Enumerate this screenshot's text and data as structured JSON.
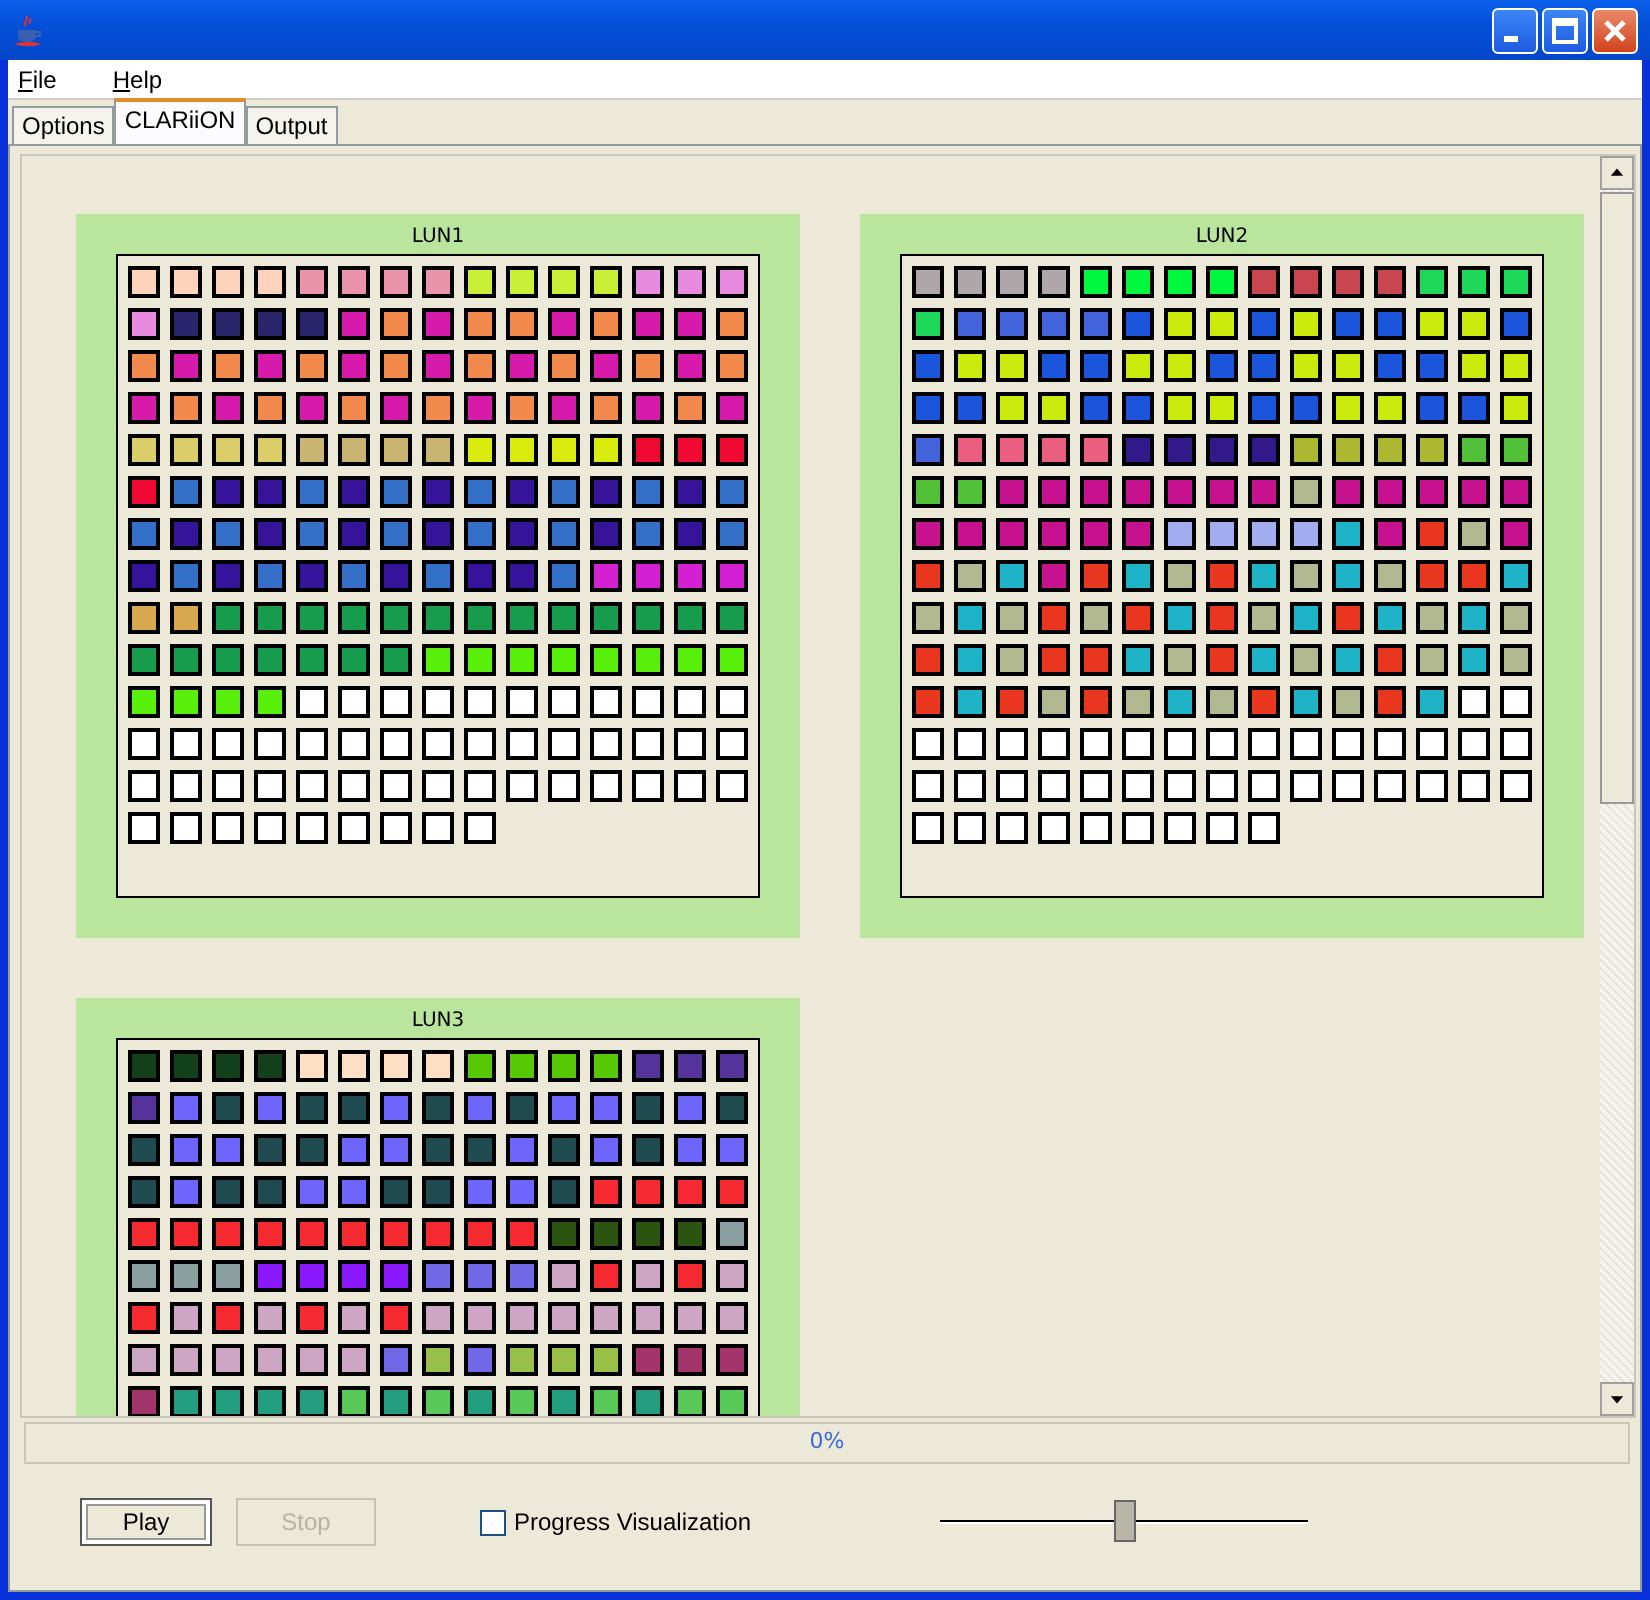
{
  "menu": [
    {
      "label": "File"
    },
    {
      "label": "Help"
    }
  ],
  "tabs": [
    {
      "label": "Options",
      "selected": false
    },
    {
      "label": "CLARiiON",
      "selected": true
    },
    {
      "label": "Output",
      "selected": false
    }
  ],
  "luns": [
    {
      "title": "LUN1",
      "blocks": [
        {
          "color": "#fdd3bb"
        },
        {
          "color": "#fdd3bb"
        },
        {
          "color": "#fdd3bb"
        },
        {
          "color": "#fdd3bb"
        },
        {
          "color": "#ea93ab"
        },
        {
          "color": "#ea93ab"
        },
        {
          "color": "#ea93ab"
        },
        {
          "color": "#ea93ab"
        },
        {
          "color": "#cbef37"
        },
        {
          "color": "#cbef37"
        },
        {
          "color": "#cbef37"
        },
        {
          "color": "#cbef37"
        },
        {
          "color": "#e88ae0"
        },
        {
          "color": "#e88ae0"
        },
        {
          "color": "#e88ae0"
        },
        {
          "color": "#e88ae0"
        },
        {
          "color": "#2a246a"
        },
        {
          "color": "#2a246a"
        },
        {
          "color": "#2a246a"
        },
        {
          "color": "#2a246a"
        },
        {
          "color": "#d61aac"
        },
        {
          "color": "#f28a4e"
        },
        {
          "color": "#d61aac"
        },
        {
          "color": "#f28a4e"
        },
        {
          "color": "#f28a4e"
        },
        {
          "color": "#d61aac"
        },
        {
          "color": "#f28a4e"
        },
        {
          "color": "#d61aac"
        },
        {
          "color": "#d61aac"
        },
        {
          "color": "#f28a4e"
        },
        {
          "color": "#f28a4e"
        },
        {
          "color": "#d61aac"
        },
        {
          "color": "#f28a4e"
        },
        {
          "color": "#d61aac"
        },
        {
          "color": "#f28a4e"
        },
        {
          "color": "#d61aac"
        },
        {
          "color": "#f28a4e"
        },
        {
          "color": "#d61aac"
        },
        {
          "color": "#f28a4e"
        },
        {
          "color": "#d61aac"
        },
        {
          "color": "#f28a4e"
        },
        {
          "color": "#d61aac"
        },
        {
          "color": "#f28a4e"
        },
        {
          "color": "#d61aac"
        },
        {
          "color": "#f28a4e"
        },
        {
          "color": "#d61aac"
        },
        {
          "color": "#f28a4e"
        },
        {
          "color": "#d61aac"
        },
        {
          "color": "#f28a4e"
        },
        {
          "color": "#d61aac"
        },
        {
          "color": "#f28a4e"
        },
        {
          "color": "#d61aac"
        },
        {
          "color": "#f28a4e"
        },
        {
          "color": "#d61aac"
        },
        {
          "color": "#f28a4e"
        },
        {
          "color": "#d61aac"
        },
        {
          "color": "#f28a4e"
        },
        {
          "color": "#d61aac"
        },
        {
          "color": "#f28a4e"
        },
        {
          "color": "#d61aac"
        },
        {
          "color": "#dbcd69"
        },
        {
          "color": "#dbcd69"
        },
        {
          "color": "#dbcd69"
        },
        {
          "color": "#dbcd69"
        },
        {
          "color": "#c9b472"
        },
        {
          "color": "#c9b472"
        },
        {
          "color": "#c9b472"
        },
        {
          "color": "#c9b472"
        },
        {
          "color": "#d9ec0e"
        },
        {
          "color": "#d9ec0e"
        },
        {
          "color": "#d9ec0e"
        },
        {
          "color": "#d9ec0e"
        },
        {
          "color": "#f00a33"
        },
        {
          "color": "#f00a33"
        },
        {
          "color": "#f00a33"
        },
        {
          "color": "#f00a33"
        },
        {
          "color": "#3570c8"
        },
        {
          "color": "#36149a"
        },
        {
          "color": "#36149a"
        },
        {
          "color": "#3570c8"
        },
        {
          "color": "#36149a"
        },
        {
          "color": "#3570c8"
        },
        {
          "color": "#36149a"
        },
        {
          "color": "#3570c8"
        },
        {
          "color": "#36149a"
        },
        {
          "color": "#3570c8"
        },
        {
          "color": "#36149a"
        },
        {
          "color": "#3570c8"
        },
        {
          "color": "#36149a"
        },
        {
          "color": "#3570c8"
        },
        {
          "color": "#3570c8"
        },
        {
          "color": "#36149a"
        },
        {
          "color": "#3570c8"
        },
        {
          "color": "#36149a"
        },
        {
          "color": "#3570c8"
        },
        {
          "color": "#36149a"
        },
        {
          "color": "#3570c8"
        },
        {
          "color": "#36149a"
        },
        {
          "color": "#3570c8"
        },
        {
          "color": "#36149a"
        },
        {
          "color": "#3570c8"
        },
        {
          "color": "#36149a"
        },
        {
          "color": "#3570c8"
        },
        {
          "color": "#36149a"
        },
        {
          "color": "#3570c8"
        },
        {
          "color": "#36149a"
        },
        {
          "color": "#3570c8"
        },
        {
          "color": "#36149a"
        },
        {
          "color": "#3570c8"
        },
        {
          "color": "#36149a"
        },
        {
          "color": "#3570c8"
        },
        {
          "color": "#36149a"
        },
        {
          "color": "#3570c8"
        },
        {
          "color": "#36149a"
        },
        {
          "color": "#36149a"
        },
        {
          "color": "#3570c8"
        },
        {
          "color": "#d41fd2"
        },
        {
          "color": "#d41fd2"
        },
        {
          "color": "#d41fd2"
        },
        {
          "color": "#d41fd2"
        },
        {
          "color": "#d8a84e"
        },
        {
          "color": "#d8a84e"
        },
        {
          "color": "#179c4e"
        },
        {
          "color": "#179c4e"
        },
        {
          "color": "#179c4e"
        },
        {
          "color": "#179c4e"
        },
        {
          "color": "#179c4e"
        },
        {
          "color": "#179c4e"
        },
        {
          "color": "#179c4e"
        },
        {
          "color": "#179c4e"
        },
        {
          "color": "#179c4e"
        },
        {
          "color": "#179c4e"
        },
        {
          "color": "#179c4e"
        },
        {
          "color": "#179c4e"
        },
        {
          "color": "#179c4e"
        },
        {
          "color": "#179c4e"
        },
        {
          "color": "#179c4e"
        },
        {
          "color": "#179c4e"
        },
        {
          "color": "#179c4e"
        },
        {
          "color": "#179c4e"
        },
        {
          "color": "#179c4e"
        },
        {
          "color": "#179c4e"
        },
        {
          "color": "#58f00a"
        },
        {
          "color": "#58f00a"
        },
        {
          "color": "#58f00a"
        },
        {
          "color": "#58f00a"
        },
        {
          "color": "#58f00a"
        },
        {
          "color": "#58f00a"
        },
        {
          "color": "#58f00a"
        },
        {
          "color": "#58f00a"
        },
        {
          "color": "#58f00a"
        },
        {
          "color": "#58f00a"
        },
        {
          "color": "#58f00a"
        },
        {
          "color": "#58f00a"
        },
        {
          "color": "#ffffff"
        },
        {
          "color": "#ffffff"
        },
        {
          "color": "#ffffff"
        },
        {
          "color": "#ffffff"
        },
        {
          "color": "#ffffff"
        },
        {
          "color": "#ffffff"
        },
        {
          "color": "#ffffff"
        },
        {
          "color": "#ffffff"
        },
        {
          "color": "#ffffff"
        },
        {
          "color": "#ffffff"
        },
        {
          "color": "#ffffff"
        },
        {
          "color": "#ffffff"
        },
        {
          "color": "#ffffff"
        },
        {
          "color": "#ffffff"
        },
        {
          "color": "#ffffff"
        },
        {
          "color": "#ffffff"
        },
        {
          "color": "#ffffff"
        },
        {
          "color": "#ffffff"
        },
        {
          "color": "#ffffff"
        },
        {
          "color": "#ffffff"
        },
        {
          "color": "#ffffff"
        },
        {
          "color": "#ffffff"
        },
        {
          "color": "#ffffff"
        },
        {
          "color": "#ffffff"
        },
        {
          "color": "#ffffff"
        },
        {
          "color": "#ffffff"
        },
        {
          "color": "#ffffff"
        },
        {
          "color": "#ffffff"
        },
        {
          "color": "#ffffff"
        },
        {
          "color": "#ffffff"
        },
        {
          "color": "#ffffff"
        },
        {
          "color": "#ffffff"
        },
        {
          "color": "#ffffff"
        },
        {
          "color": "#ffffff"
        },
        {
          "color": "#ffffff"
        },
        {
          "color": "#ffffff"
        },
        {
          "color": "#ffffff"
        },
        {
          "color": "#ffffff"
        },
        {
          "color": "#ffffff"
        },
        {
          "color": "#ffffff"
        },
        {
          "color": "#ffffff"
        },
        {
          "color": "#ffffff"
        },
        {
          "color": "#ffffff"
        },
        {
          "color": "#ffffff"
        },
        {
          "color": "#ffffff"
        },
        {
          "color": "#ffffff"
        },
        {
          "color": "#ffffff"
        },
        {
          "color": "#ffffff"
        },
        {
          "color": "#ffffff"
        },
        {
          "color": "#ffffff"
        }
      ]
    },
    {
      "title": "LUN2",
      "blocks": [
        {
          "color": "#aea6a8"
        },
        {
          "color": "#aea6a8"
        },
        {
          "color": "#aea6a8"
        },
        {
          "color": "#aea6a8"
        },
        {
          "color": "#00f83f"
        },
        {
          "color": "#00f83f"
        },
        {
          "color": "#00f83f"
        },
        {
          "color": "#00f83f"
        },
        {
          "color": "#c84650"
        },
        {
          "color": "#c84650"
        },
        {
          "color": "#c84650"
        },
        {
          "color": "#c84650"
        },
        {
          "color": "#1ed859"
        },
        {
          "color": "#1ed859"
        },
        {
          "color": "#1ed859"
        },
        {
          "color": "#1ed859"
        },
        {
          "color": "#4263da"
        },
        {
          "color": "#4263da"
        },
        {
          "color": "#4263da"
        },
        {
          "color": "#4263da"
        },
        {
          "color": "#1a55dc"
        },
        {
          "color": "#cbeb0c"
        },
        {
          "color": "#cbeb0c"
        },
        {
          "color": "#1a55dc"
        },
        {
          "color": "#cbeb0c"
        },
        {
          "color": "#1a55dc"
        },
        {
          "color": "#1a55dc"
        },
        {
          "color": "#cbeb0c"
        },
        {
          "color": "#cbeb0c"
        },
        {
          "color": "#1a55dc"
        },
        {
          "color": "#1a55dc"
        },
        {
          "color": "#cbeb0c"
        },
        {
          "color": "#cbeb0c"
        },
        {
          "color": "#1a55dc"
        },
        {
          "color": "#1a55dc"
        },
        {
          "color": "#cbeb0c"
        },
        {
          "color": "#cbeb0c"
        },
        {
          "color": "#1a55dc"
        },
        {
          "color": "#1a55dc"
        },
        {
          "color": "#cbeb0c"
        },
        {
          "color": "#cbeb0c"
        },
        {
          "color": "#1a55dc"
        },
        {
          "color": "#1a55dc"
        },
        {
          "color": "#cbeb0c"
        },
        {
          "color": "#cbeb0c"
        },
        {
          "color": "#1a55dc"
        },
        {
          "color": "#1a55dc"
        },
        {
          "color": "#cbeb0c"
        },
        {
          "color": "#cbeb0c"
        },
        {
          "color": "#1a55dc"
        },
        {
          "color": "#1a55dc"
        },
        {
          "color": "#cbeb0c"
        },
        {
          "color": "#cbeb0c"
        },
        {
          "color": "#1a55dc"
        },
        {
          "color": "#1a55dc"
        },
        {
          "color": "#cbeb0c"
        },
        {
          "color": "#cbeb0c"
        },
        {
          "color": "#1a55dc"
        },
        {
          "color": "#1a55dc"
        },
        {
          "color": "#cbeb0c"
        },
        {
          "color": "#4263da"
        },
        {
          "color": "#ea5e80"
        },
        {
          "color": "#ea5e80"
        },
        {
          "color": "#ea5e80"
        },
        {
          "color": "#ea5e80"
        },
        {
          "color": "#31198a"
        },
        {
          "color": "#31198a"
        },
        {
          "color": "#31198a"
        },
        {
          "color": "#31198a"
        },
        {
          "color": "#adb832"
        },
        {
          "color": "#adb832"
        },
        {
          "color": "#adb832"
        },
        {
          "color": "#adb832"
        },
        {
          "color": "#52c038"
        },
        {
          "color": "#52c038"
        },
        {
          "color": "#52c038"
        },
        {
          "color": "#52c038"
        },
        {
          "color": "#c6128e"
        },
        {
          "color": "#c6128e"
        },
        {
          "color": "#c6128e"
        },
        {
          "color": "#c6128e"
        },
        {
          "color": "#c6128e"
        },
        {
          "color": "#c6128e"
        },
        {
          "color": "#c6128e"
        },
        {
          "color": "#b2b990"
        },
        {
          "color": "#c6128e"
        },
        {
          "color": "#c6128e"
        },
        {
          "color": "#c6128e"
        },
        {
          "color": "#c6128e"
        },
        {
          "color": "#c6128e"
        },
        {
          "color": "#c6128e"
        },
        {
          "color": "#c6128e"
        },
        {
          "color": "#c6128e"
        },
        {
          "color": "#c6128e"
        },
        {
          "color": "#c6128e"
        },
        {
          "color": "#c6128e"
        },
        {
          "color": "#a0aef0"
        },
        {
          "color": "#a0aef0"
        },
        {
          "color": "#a0aef0"
        },
        {
          "color": "#a0aef0"
        },
        {
          "color": "#1fb3c8"
        },
        {
          "color": "#c6128e"
        },
        {
          "color": "#e8361f"
        },
        {
          "color": "#b2b990"
        },
        {
          "color": "#c6128e"
        },
        {
          "color": "#e8361f"
        },
        {
          "color": "#b2b990"
        },
        {
          "color": "#1fb3c8"
        },
        {
          "color": "#c6128e"
        },
        {
          "color": "#e8361f"
        },
        {
          "color": "#1fb3c8"
        },
        {
          "color": "#b2b990"
        },
        {
          "color": "#e8361f"
        },
        {
          "color": "#1fb3c8"
        },
        {
          "color": "#b2b990"
        },
        {
          "color": "#1fb3c8"
        },
        {
          "color": "#b2b990"
        },
        {
          "color": "#e8361f"
        },
        {
          "color": "#e8361f"
        },
        {
          "color": "#1fb3c8"
        },
        {
          "color": "#b2b990"
        },
        {
          "color": "#1fb3c8"
        },
        {
          "color": "#b2b990"
        },
        {
          "color": "#e8361f"
        },
        {
          "color": "#b2b990"
        },
        {
          "color": "#e8361f"
        },
        {
          "color": "#1fb3c8"
        },
        {
          "color": "#e8361f"
        },
        {
          "color": "#b2b990"
        },
        {
          "color": "#1fb3c8"
        },
        {
          "color": "#e8361f"
        },
        {
          "color": "#1fb3c8"
        },
        {
          "color": "#b2b990"
        },
        {
          "color": "#1fb3c8"
        },
        {
          "color": "#b2b990"
        },
        {
          "color": "#e8361f"
        },
        {
          "color": "#1fb3c8"
        },
        {
          "color": "#b2b990"
        },
        {
          "color": "#e8361f"
        },
        {
          "color": "#e8361f"
        },
        {
          "color": "#1fb3c8"
        },
        {
          "color": "#b2b990"
        },
        {
          "color": "#e8361f"
        },
        {
          "color": "#1fb3c8"
        },
        {
          "color": "#b2b990"
        },
        {
          "color": "#1fb3c8"
        },
        {
          "color": "#e8361f"
        },
        {
          "color": "#b2b990"
        },
        {
          "color": "#1fb3c8"
        },
        {
          "color": "#b2b990"
        },
        {
          "color": "#e8361f"
        },
        {
          "color": "#1fb3c8"
        },
        {
          "color": "#e8361f"
        },
        {
          "color": "#b2b990"
        },
        {
          "color": "#e8361f"
        },
        {
          "color": "#b2b990"
        },
        {
          "color": "#1fb3c8"
        },
        {
          "color": "#b2b990"
        },
        {
          "color": "#e8361f"
        },
        {
          "color": "#1fb3c8"
        },
        {
          "color": "#b2b990"
        },
        {
          "color": "#e8361f"
        },
        {
          "color": "#1fb3c8"
        },
        {
          "color": "#ffffff"
        },
        {
          "color": "#ffffff"
        },
        {
          "color": "#ffffff"
        },
        {
          "color": "#ffffff"
        },
        {
          "color": "#ffffff"
        },
        {
          "color": "#ffffff"
        },
        {
          "color": "#ffffff"
        },
        {
          "color": "#ffffff"
        },
        {
          "color": "#ffffff"
        },
        {
          "color": "#ffffff"
        },
        {
          "color": "#ffffff"
        },
        {
          "color": "#ffffff"
        },
        {
          "color": "#ffffff"
        },
        {
          "color": "#ffffff"
        },
        {
          "color": "#ffffff"
        },
        {
          "color": "#ffffff"
        },
        {
          "color": "#ffffff"
        },
        {
          "color": "#ffffff"
        },
        {
          "color": "#ffffff"
        },
        {
          "color": "#ffffff"
        },
        {
          "color": "#ffffff"
        },
        {
          "color": "#ffffff"
        },
        {
          "color": "#ffffff"
        },
        {
          "color": "#ffffff"
        },
        {
          "color": "#ffffff"
        },
        {
          "color": "#ffffff"
        },
        {
          "color": "#ffffff"
        },
        {
          "color": "#ffffff"
        },
        {
          "color": "#ffffff"
        },
        {
          "color": "#ffffff"
        },
        {
          "color": "#ffffff"
        },
        {
          "color": "#ffffff"
        },
        {
          "color": "#ffffff"
        },
        {
          "color": "#ffffff"
        },
        {
          "color": "#ffffff"
        },
        {
          "color": "#ffffff"
        },
        {
          "color": "#ffffff"
        },
        {
          "color": "#ffffff"
        },
        {
          "color": "#ffffff"
        },
        {
          "color": "#ffffff"
        },
        {
          "color": "#ffffff"
        }
      ]
    },
    {
      "title": "LUN3",
      "blocks": [
        {
          "color": "#12401a"
        },
        {
          "color": "#12401a"
        },
        {
          "color": "#12401a"
        },
        {
          "color": "#12401a"
        },
        {
          "color": "#fde0c4"
        },
        {
          "color": "#fde0c4"
        },
        {
          "color": "#fde0c4"
        },
        {
          "color": "#fde0c4"
        },
        {
          "color": "#56c806"
        },
        {
          "color": "#56c806"
        },
        {
          "color": "#56c806"
        },
        {
          "color": "#56c806"
        },
        {
          "color": "#54349a"
        },
        {
          "color": "#54349a"
        },
        {
          "color": "#54349a"
        },
        {
          "color": "#54349a"
        },
        {
          "color": "#6e66fc"
        },
        {
          "color": "#1e4a50"
        },
        {
          "color": "#6e66fc"
        },
        {
          "color": "#1e4a50"
        },
        {
          "color": "#1e4a50"
        },
        {
          "color": "#6e66fc"
        },
        {
          "color": "#1e4a50"
        },
        {
          "color": "#6e66fc"
        },
        {
          "color": "#1e4a50"
        },
        {
          "color": "#6e66fc"
        },
        {
          "color": "#6e66fc"
        },
        {
          "color": "#1e4a50"
        },
        {
          "color": "#6e66fc"
        },
        {
          "color": "#1e4a50"
        },
        {
          "color": "#1e4a50"
        },
        {
          "color": "#6e66fc"
        },
        {
          "color": "#6e66fc"
        },
        {
          "color": "#1e4a50"
        },
        {
          "color": "#1e4a50"
        },
        {
          "color": "#6e66fc"
        },
        {
          "color": "#6e66fc"
        },
        {
          "color": "#1e4a50"
        },
        {
          "color": "#1e4a50"
        },
        {
          "color": "#6e66fc"
        },
        {
          "color": "#1e4a50"
        },
        {
          "color": "#6e66fc"
        },
        {
          "color": "#1e4a50"
        },
        {
          "color": "#6e66fc"
        },
        {
          "color": "#6e66fc"
        },
        {
          "color": "#1e4a50"
        },
        {
          "color": "#6e66fc"
        },
        {
          "color": "#1e4a50"
        },
        {
          "color": "#1e4a50"
        },
        {
          "color": "#6e66fc"
        },
        {
          "color": "#6e66fc"
        },
        {
          "color": "#1e4a50"
        },
        {
          "color": "#1e4a50"
        },
        {
          "color": "#6e66fc"
        },
        {
          "color": "#6e66fc"
        },
        {
          "color": "#1e4a50"
        },
        {
          "color": "#f42a30"
        },
        {
          "color": "#f42a30"
        },
        {
          "color": "#f42a30"
        },
        {
          "color": "#f42a30"
        },
        {
          "color": "#f42a30"
        },
        {
          "color": "#f42a30"
        },
        {
          "color": "#f42a30"
        },
        {
          "color": "#f42a30"
        },
        {
          "color": "#f42a30"
        },
        {
          "color": "#f42a30"
        },
        {
          "color": "#f42a30"
        },
        {
          "color": "#f42a30"
        },
        {
          "color": "#f42a30"
        },
        {
          "color": "#f42a30"
        },
        {
          "color": "#2a5410"
        },
        {
          "color": "#2a5410"
        },
        {
          "color": "#2a5410"
        },
        {
          "color": "#2a5410"
        },
        {
          "color": "#8aa0a0"
        },
        {
          "color": "#8aa0a0"
        },
        {
          "color": "#8aa0a0"
        },
        {
          "color": "#8aa0a0"
        },
        {
          "color": "#8a18fc"
        },
        {
          "color": "#8a18fc"
        },
        {
          "color": "#8a18fc"
        },
        {
          "color": "#8a18fc"
        },
        {
          "color": "#7068e4"
        },
        {
          "color": "#7068e4"
        },
        {
          "color": "#7068e4"
        },
        {
          "color": "#cca6c2"
        },
        {
          "color": "#f42a30"
        },
        {
          "color": "#cca6c2"
        },
        {
          "color": "#f42a30"
        },
        {
          "color": "#cca6c2"
        },
        {
          "color": "#f42a30"
        },
        {
          "color": "#cca6c2"
        },
        {
          "color": "#f42a30"
        },
        {
          "color": "#cca6c2"
        },
        {
          "color": "#f42a30"
        },
        {
          "color": "#cca6c2"
        },
        {
          "color": "#f42a30"
        },
        {
          "color": "#cca6c2"
        },
        {
          "color": "#cca6c2"
        },
        {
          "color": "#cca6c2"
        },
        {
          "color": "#cca6c2"
        },
        {
          "color": "#cca6c2"
        },
        {
          "color": "#cca6c2"
        },
        {
          "color": "#cca6c2"
        },
        {
          "color": "#cca6c2"
        },
        {
          "color": "#cca6c2"
        },
        {
          "color": "#cca6c2"
        },
        {
          "color": "#cca6c2"
        },
        {
          "color": "#cca6c2"
        },
        {
          "color": "#cca6c2"
        },
        {
          "color": "#cca6c2"
        },
        {
          "color": "#7068e4"
        },
        {
          "color": "#98c046"
        },
        {
          "color": "#7068e4"
        },
        {
          "color": "#98c046"
        },
        {
          "color": "#98c046"
        },
        {
          "color": "#98c046"
        },
        {
          "color": "#a2346a"
        },
        {
          "color": "#a2346a"
        },
        {
          "color": "#a2346a"
        },
        {
          "color": "#a2346a"
        },
        {
          "color": "#229e7e"
        },
        {
          "color": "#229e7e"
        },
        {
          "color": "#229e7e"
        },
        {
          "color": "#229e7e"
        },
        {
          "color": "#58c858"
        },
        {
          "color": "#229e7e"
        },
        {
          "color": "#58c858"
        },
        {
          "color": "#229e7e"
        },
        {
          "color": "#58c858"
        },
        {
          "color": "#229e7e"
        },
        {
          "color": "#58c858"
        },
        {
          "color": "#229e7e"
        },
        {
          "color": "#58c858"
        },
        {
          "color": "#58c858"
        }
      ]
    }
  ],
  "progress": {
    "label": "0%",
    "level": 0
  },
  "buttons": [
    {
      "label": "Play",
      "disabled": false
    },
    {
      "label": "Stop",
      "disabled": true
    }
  ],
  "progress_visualization": {
    "label": "Progress Visualization",
    "checked": false
  },
  "speed_slider": {
    "level": 0.5
  }
}
